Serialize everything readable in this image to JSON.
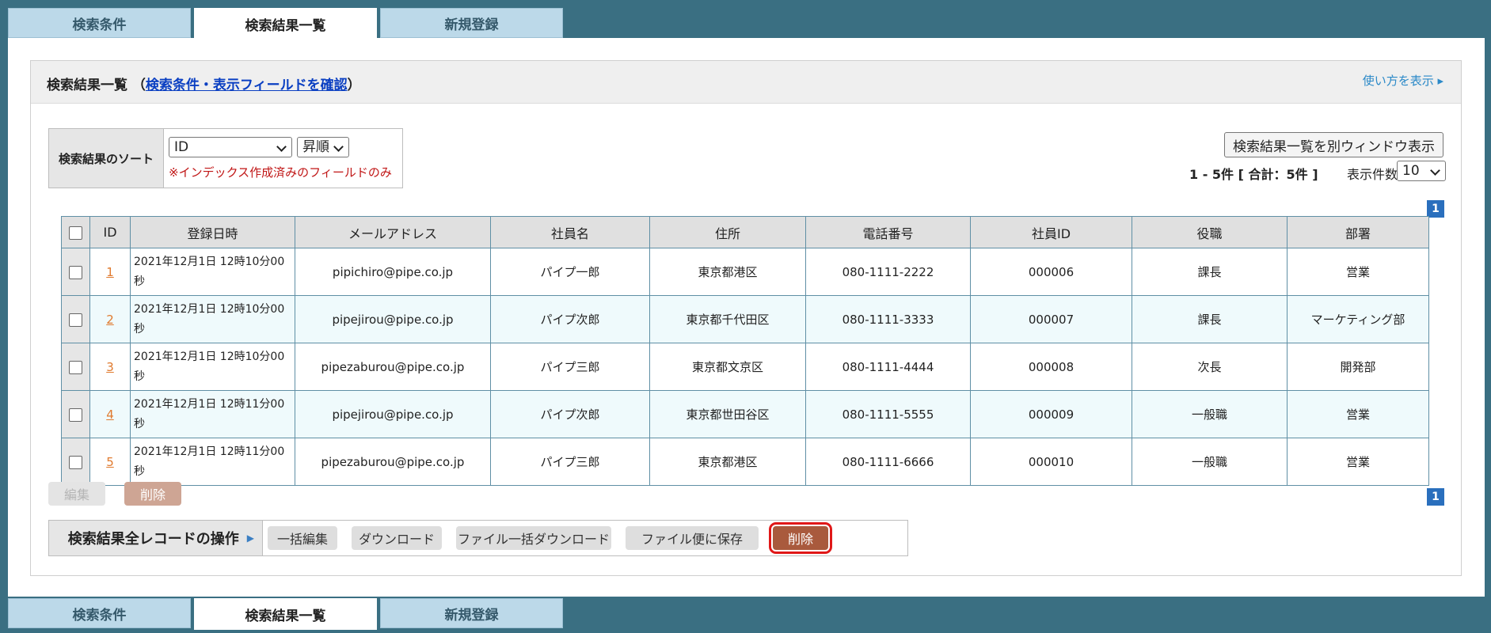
{
  "tabs": [
    "検索条件",
    "検索結果一覧",
    "新規登録"
  ],
  "active_tab": 1,
  "panel": {
    "title_prefix": "検索結果一覧 （",
    "title_link": "検索条件・表示フィールドを確認",
    "title_suffix": "）",
    "help_link": "使い方を表示 ▸"
  },
  "sort": {
    "label": "検索結果のソート",
    "field_value": "ID",
    "order_value": "昇順",
    "note": "※インデックス作成済みのフィールドのみ"
  },
  "open_window_button": "検索結果一覧を別ウィンドウ表示",
  "count_text": "1 - 5件 [ 合計：5件 ]",
  "per_page": {
    "label": "表示件数",
    "value": "10"
  },
  "pager": {
    "current": "1"
  },
  "table": {
    "headers": [
      "ID",
      "登録日時",
      "メールアドレス",
      "社員名",
      "住所",
      "電話番号",
      "社員ID",
      "役職",
      "部署"
    ],
    "rows": [
      [
        "1",
        "2021年12月1日 12時10分00秒",
        "pipichiro@pipe.co.jp",
        "パイプ一郎",
        "東京都港区",
        "080-1111-2222",
        "000006",
        "課長",
        "営業"
      ],
      [
        "2",
        "2021年12月1日 12時10分00秒",
        "pipejirou@pipe.co.jp",
        "パイプ次郎",
        "東京都千代田区",
        "080-1111-3333",
        "000007",
        "課長",
        "マーケティング部"
      ],
      [
        "3",
        "2021年12月1日 12時10分00秒",
        "pipezaburou@pipe.co.jp",
        "パイプ三郎",
        "東京都文京区",
        "080-1111-4444",
        "000008",
        "次長",
        "開発部"
      ],
      [
        "4",
        "2021年12月1日 12時11分00秒",
        "pipejirou@pipe.co.jp",
        "パイプ次郎",
        "東京都世田谷区",
        "080-1111-5555",
        "000009",
        "一般職",
        "営業"
      ],
      [
        "5",
        "2021年12月1日 12時11分00秒",
        "pipezaburou@pipe.co.jp",
        "パイプ三郎",
        "東京都港区",
        "080-1111-6666",
        "000010",
        "一般職",
        "営業"
      ]
    ]
  },
  "row_actions": {
    "edit": "編集",
    "delete": "削除"
  },
  "all_ops": {
    "label": "検索結果全レコードの操作",
    "buttons": [
      "一括編集",
      "ダウンロード",
      "ファイル一括ダウンロード",
      "ファイル便に保存",
      "削除"
    ]
  },
  "colors": {
    "background": "#3a6f82",
    "tab": "#bcd9e9",
    "pager": "#2a6fbd",
    "id_link": "#e07a2e",
    "delete_button": "#a95a3d",
    "highlight": "#e01818"
  }
}
